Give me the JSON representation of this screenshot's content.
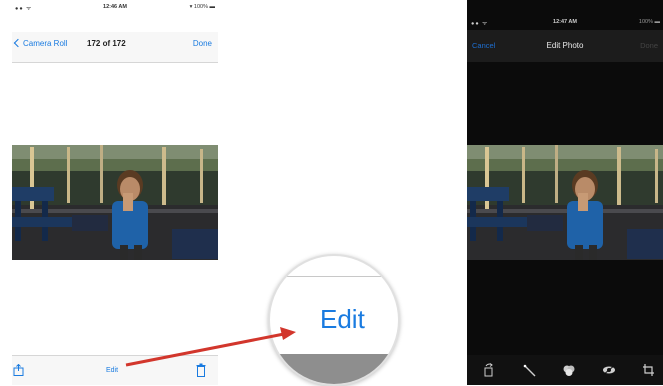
{
  "left": {
    "status": {
      "signal": "●● ᯤ",
      "time": "12:46 AM",
      "battery": "▾ 100% ▬"
    },
    "nav": {
      "back_label": "Camera Roll",
      "title": "172 of 172",
      "done_label": "Done"
    },
    "toolbar": {
      "edit_label": "Edit"
    }
  },
  "magnifier": {
    "edit_label": "Edit"
  },
  "right": {
    "status": {
      "signal": "●● ᯤ",
      "time": "12:47 AM",
      "battery": "100% ▬"
    },
    "nav": {
      "cancel_label": "Cancel",
      "title": "Edit Photo",
      "done_label": "Done"
    }
  },
  "colors": {
    "ios_blue": "#1a7be0",
    "arrow_red": "#d2362c",
    "dark_background": "#0b0b0b"
  },
  "icons": {
    "share": "share-icon",
    "trash": "trash-icon",
    "rotate": "rotate-icon",
    "enhance": "magic-wand-icon",
    "filters": "filters-icon",
    "red_eye": "red-eye-icon",
    "crop": "crop-icon"
  }
}
